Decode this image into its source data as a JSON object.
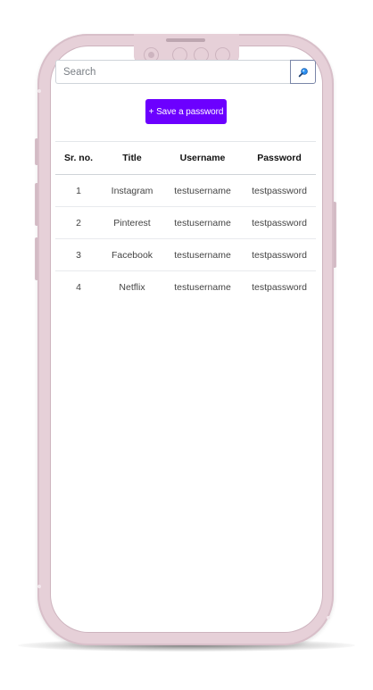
{
  "search": {
    "placeholder": "Search"
  },
  "actions": {
    "save_label": "+ Save a password"
  },
  "table": {
    "headers": [
      "Sr. no.",
      "Title",
      "Username",
      "Password"
    ],
    "rows": [
      {
        "sr": "1",
        "title": "Instagram",
        "username": "testusername",
        "password": "testpassword"
      },
      {
        "sr": "2",
        "title": "Pinterest",
        "username": "testusername",
        "password": "testpassword"
      },
      {
        "sr": "3",
        "title": "Facebook",
        "username": "testusername",
        "password": "testpassword"
      },
      {
        "sr": "4",
        "title": "Netflix",
        "username": "testusername",
        "password": "testpassword"
      }
    ]
  },
  "icons": {
    "search_button": "search-icon"
  },
  "colors": {
    "accent": "#6c00ff",
    "phone_frame": "#e6d0d8",
    "search_icon": "#2a8ff0"
  }
}
